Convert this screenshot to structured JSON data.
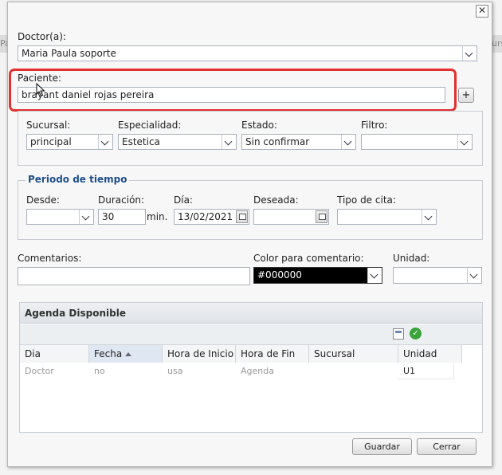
{
  "background": {
    "tab_left": "Pa",
    "tab_right": "urs"
  },
  "dialog": {
    "close_glyph": "✕",
    "doctor": {
      "label": "Doctor(a):",
      "value": "Maria Paula soporte"
    },
    "paciente": {
      "label": "Paciente:",
      "value": "brayant daniel rojas pereira",
      "add_glyph": "+"
    },
    "filters": {
      "sucursal": {
        "label": "Sucursal:",
        "value": "principal"
      },
      "especialidad": {
        "label": "Especialidad:",
        "value": "Estetica"
      },
      "estado": {
        "label": "Estado:",
        "value": "Sin confirmar"
      },
      "filtro": {
        "label": "Filtro:",
        "value": ""
      }
    },
    "periodo": {
      "legend": "Periodo de tiempo",
      "desde": {
        "label": "Desde:",
        "value": ""
      },
      "duracion": {
        "label": "Duración:",
        "value": "30",
        "unit": "min."
      },
      "dia": {
        "label": "Día:",
        "value": "13/02/2021"
      },
      "deseada": {
        "label": "Deseada:",
        "value": ""
      },
      "tipo_cita": {
        "label": "Tipo de cita:",
        "value": ""
      }
    },
    "comentarios": {
      "label": "Comentarios:",
      "value": ""
    },
    "color_comentario": {
      "label": "Color para comentario:",
      "value": "#000000"
    },
    "unidad": {
      "label": "Unidad:",
      "value": ""
    },
    "agenda": {
      "title": "Agenda Disponible",
      "columns": [
        "Dia",
        "Fecha",
        "Hora de Inicio",
        "Hora de Fin",
        "Sucursal",
        "Unidad"
      ],
      "rows": [
        {
          "dia": "Doctor",
          "fecha": "no",
          "hora_inicio": "usa",
          "hora_fin": "Agenda",
          "sucursal": "",
          "unidad": "U1"
        }
      ]
    },
    "buttons": {
      "guardar": "Guardar",
      "cerrar": "Cerrar"
    }
  },
  "colors": {
    "highlight": "#e0302f",
    "legend": "#1f4e8c",
    "ok_icon": "#3aa33a"
  }
}
